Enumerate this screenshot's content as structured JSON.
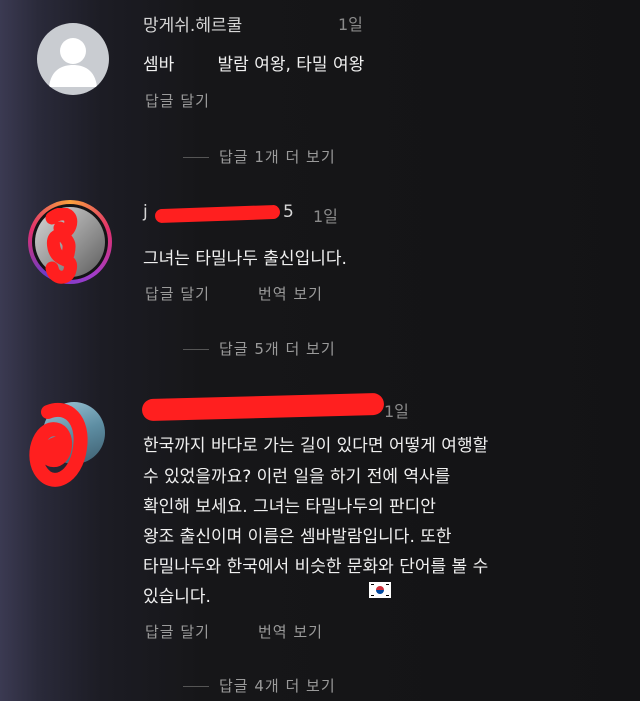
{
  "comments": [
    {
      "username": "망게쉬.헤르쿨",
      "time": "1일",
      "lines": [
        "셈바        발람 여왕, 타밀 여왕"
      ],
      "reply_label": "답글 달기",
      "more_replies": "답글 1개 더 보기"
    },
    {
      "username": "j",
      "username_tail": "5",
      "time": "1일",
      "lines": [
        "그녀는 타밀나두 출신입니다."
      ],
      "reply_label": "답글 달기",
      "translate_label": "번역 보기",
      "more_replies": "답글 5개 더 보기"
    },
    {
      "username": "",
      "time": "1일",
      "lines": [
        "한국까지 바다로 가는 길이 있다면 어떻게 여행할",
        "수 있었을까요? 이런 일을 하기 전에 역사를",
        "확인해 보세요. 그녀는 타밀나두의 판디안",
        "왕조 출신이며 이름은 셈바발람입니다. 또한",
        "타밀나두와 한국에서 비슷한 문화와 단어를 볼 수",
        "있습니다."
      ],
      "emoji": "south-korea-flag",
      "reply_label": "답글 달기",
      "translate_label": "번역 보기",
      "more_replies": "답글 4개 더 보기"
    }
  ]
}
